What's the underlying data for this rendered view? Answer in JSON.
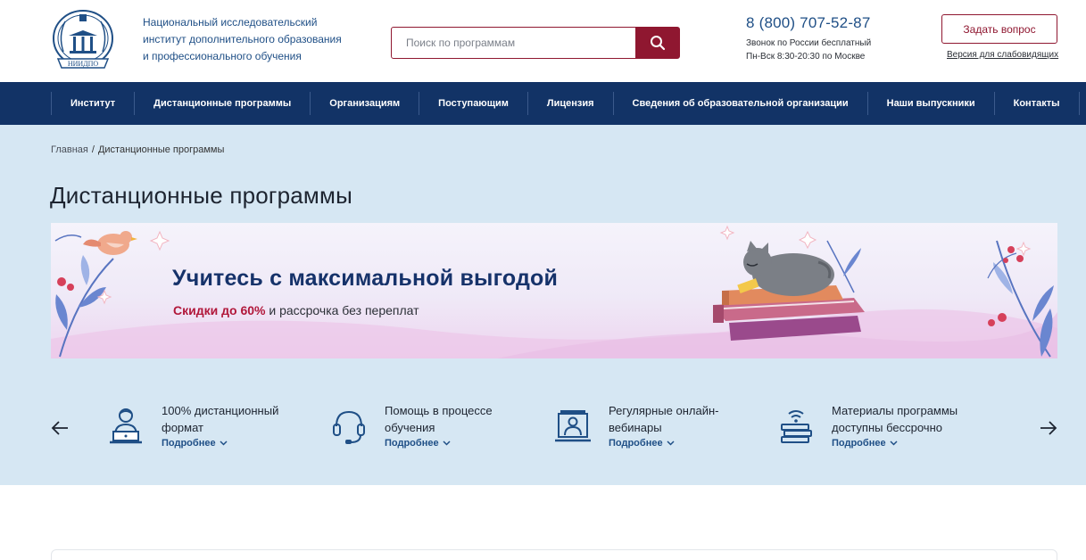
{
  "header": {
    "org_line1": "Национальный исследовательский",
    "org_line2": "институт дополнительного образования",
    "org_line3": "и профессионального обучения",
    "logo_text": "НИИДПО",
    "search_placeholder": "Поиск по программам",
    "phone": "8 (800) 707-52-87",
    "phone_note1": "Звонок по России бесплатный",
    "phone_note2": "Пн-Вск 8:30-20:30 по Москве",
    "ask_button": "Задать вопрос",
    "accessible_link": "Версия для слабовидящих"
  },
  "nav": {
    "items": [
      "Институт",
      "Дистанционные программы",
      "Организациям",
      "Поступающим",
      "Лицензия",
      "Сведения об образовательной организации",
      "Наши выпускники",
      "Контакты"
    ]
  },
  "breadcrumb": {
    "home": "Главная",
    "separator": "/",
    "current": "Дистанционные программы"
  },
  "page_title": "Дистанционные программы",
  "banner": {
    "title": "Учитесь с максимальной выгодой",
    "sub_highlight": "Скидки до 60%",
    "sub_rest": " и рассрочка без переплат"
  },
  "features": [
    {
      "line1": "100% дистанционный",
      "line2": "формат",
      "more": "Подробнее",
      "icon": "user-laptop-icon"
    },
    {
      "line1": "Помощь в процессе",
      "line2": "обучения",
      "more": "Подробнее",
      "icon": "headset-icon"
    },
    {
      "line1": "Регулярные онлайн-",
      "line2": "вебинары",
      "more": "Подробнее",
      "icon": "webinar-icon"
    },
    {
      "line1": "Материалы программы",
      "line2": "доступны бессрочно",
      "more": "Подробнее",
      "icon": "books-stack-icon"
    }
  ],
  "colors": {
    "brand_red": "#8f1730",
    "nav_blue": "#123366",
    "link_blue": "#1f4f86",
    "content_bg": "#d6e7f3"
  }
}
